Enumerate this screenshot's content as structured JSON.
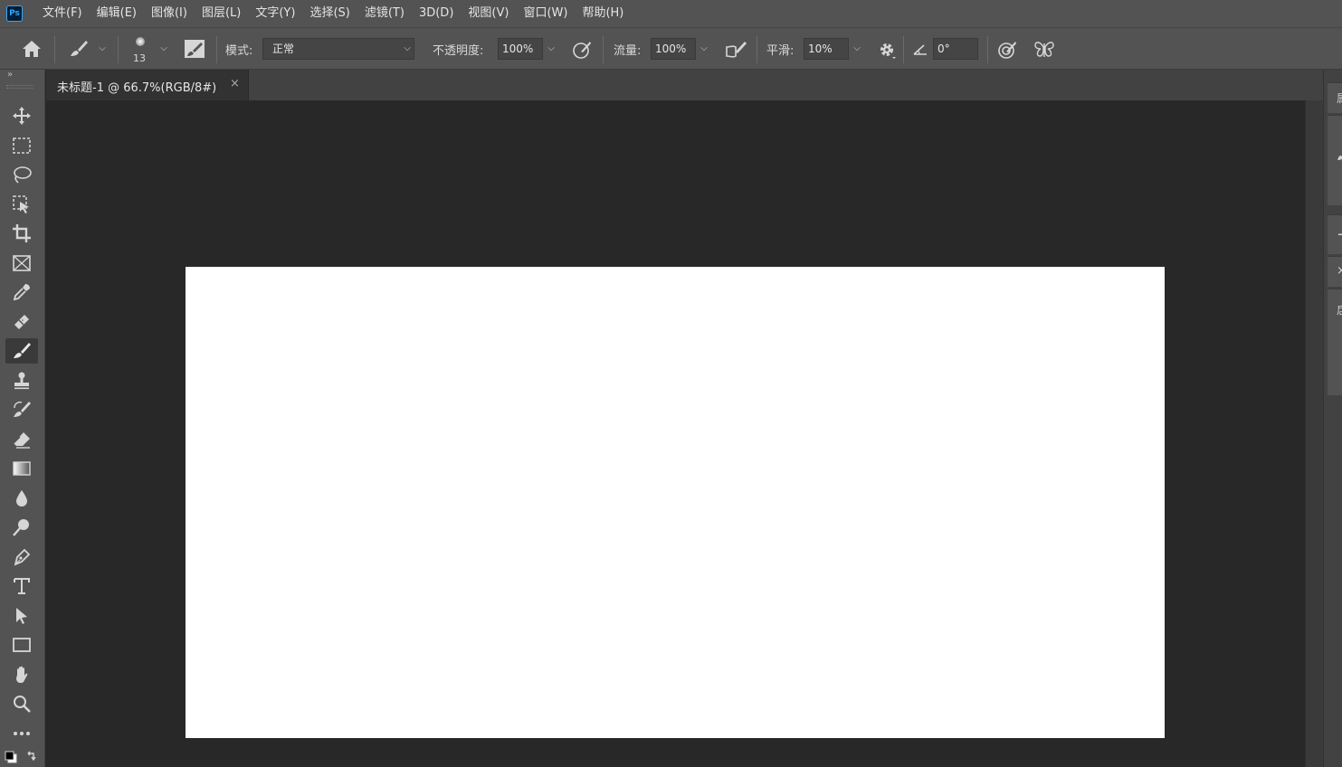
{
  "app": {
    "logo": "Ps"
  },
  "menu": [
    "文件(F)",
    "编辑(E)",
    "图像(I)",
    "图层(L)",
    "文字(Y)",
    "选择(S)",
    "滤镜(T)",
    "3D(D)",
    "视图(V)",
    "窗口(W)",
    "帮助(H)"
  ],
  "options": {
    "brush_size": "13",
    "mode_label": "模式:",
    "mode_value": "正常",
    "opacity_label": "不透明度:",
    "opacity_value": "100%",
    "flow_label": "流量:",
    "flow_value": "100%",
    "smoothing_label": "平滑:",
    "smoothing_value": "10%",
    "angle_value": "0°"
  },
  "document": {
    "tab_title": "未标题-1 @ 66.7%(RGB/8#)",
    "close_glyph": "×",
    "canvas_color": "#ffffff"
  },
  "toolbar": {
    "collapse_glyph": "»",
    "tools": [
      "move-tool",
      "rectangular-marquee-tool",
      "lasso-tool",
      "object-selection-tool",
      "crop-tool",
      "frame-tool",
      "eyedropper-tool",
      "spot-healing-brush-tool",
      "brush-tool",
      "clone-stamp-tool",
      "history-brush-tool",
      "eraser-tool",
      "gradient-tool",
      "blur-tool",
      "dodge-tool",
      "pen-tool",
      "type-tool",
      "path-selection-tool",
      "rectangle-tool",
      "hand-tool",
      "zoom-tool",
      "edit-toolbar"
    ],
    "active_tool": "brush-tool"
  },
  "right_panel": {
    "glyphs": [
      "属",
      "+",
      "×",
      "扂"
    ]
  },
  "colors": {
    "chrome": "#535353",
    "workspace": "#282828",
    "accent": "#31a8ff"
  }
}
